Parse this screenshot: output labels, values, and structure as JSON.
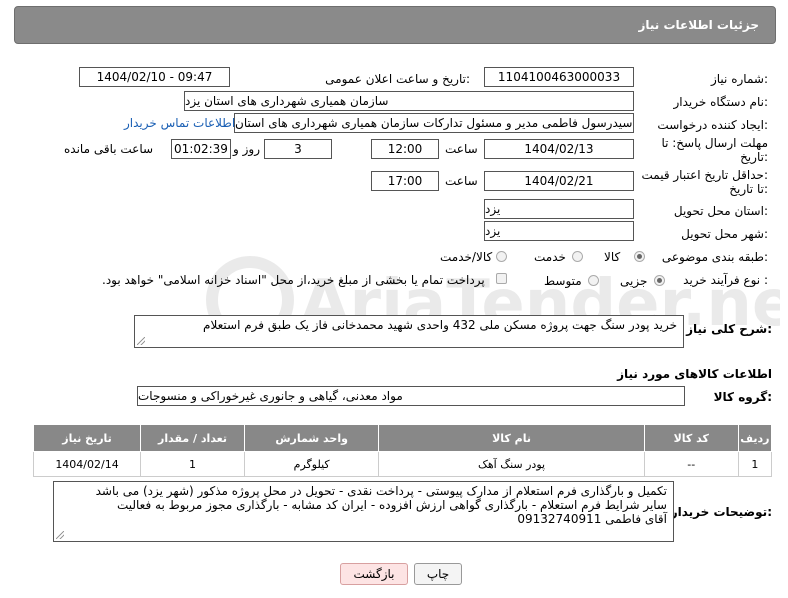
{
  "header": {
    "title": "جزئیات اطلاعات نیاز"
  },
  "form": {
    "need_number_label": "شماره نیاز:",
    "need_number": "1104100463000033",
    "announce_label": "تاریخ و ساعت اعلان عمومی:",
    "announce_value": "1404/02/10 - 09:47",
    "buyer_org_label": "نام دستگاه خریدار:",
    "buyer_org": "سازمان همیاری شهرداری های استان یزد",
    "creator_label": "ایجاد کننده درخواست:",
    "creator": "سیدرسول فاطمی مدیر و مسئول تدارکات سازمان همیاری شهرداری های استان",
    "contact_link": "اطلاعات تماس خریدار",
    "deadline_label_1": "مهلت ارسال پاسخ: تا",
    "deadline_label_2": "تاریخ:",
    "deadline_date": "1404/02/13",
    "time_label": "ساعت",
    "deadline_time": "12:00",
    "days_value": "3",
    "days_label": "روز و",
    "remaining_time": "01:02:39",
    "remaining_label": "ساعت باقی مانده",
    "validity_label_1": "حداقل تاریخ اعتبار قیمت:",
    "validity_label_2": "تا تاریخ:",
    "validity_date": "1404/02/21",
    "validity_time": "17:00",
    "province_label": "استان محل تحویل:",
    "province": "یزد",
    "city_label": "شهر محل تحویل:",
    "city": "یزد",
    "category_label": "طبقه بندی موضوعی:",
    "category_options": [
      "کالا",
      "خدمت",
      "کالا/خدمت"
    ],
    "category_selected": "کالا",
    "process_label": "نوع فرآیند خرید :",
    "process_options": [
      "جزیی",
      "متوسط"
    ],
    "process_selected": "جزیی",
    "payment_note": "پرداخت تمام یا بخشی از مبلغ خرید،از محل \"اسناد خزانه اسلامی\" خواهد بود.",
    "description_label": "شرح کلی نیاز:",
    "description": "خرید پودر سنگ جهت پروژه مسکن ملی 432 واحدی شهید محمدخانی فاز یک طبق فرم استعلام"
  },
  "goods": {
    "section_title": "اطلاعات کالاهای مورد نیاز",
    "group_label": "گروه کالا:",
    "group_value": "مواد معدنی، گیاهی و جانوری غیرخوراکی و منسوجات",
    "columns": [
      "ردیف",
      "کد کالا",
      "نام کالا",
      "واحد شمارش",
      "تعداد / مقدار",
      "تاریخ نیاز"
    ],
    "rows": [
      {
        "row": "1",
        "code": "--",
        "name": "پودر سنگ آهک",
        "unit": "کیلوگرم",
        "qty": "1",
        "date": "1404/02/14"
      }
    ]
  },
  "buyer_notes": {
    "label": "توضیحات خریدار:",
    "lines": [
      "تکمیل و بارگذاری فرم استعلام از مدارک پیوستی - پرداخت نقدی - تحویل در محل پروژه مذکور (شهر یزد) می باشد",
      "سایر شرایط فرم استعلام - بارگذاری گواهی ارزش افزوده - ایران کد مشابه - بارگذاری مجوز مربوط به فعالیت",
      "آقای فاطمی 09132740911"
    ]
  },
  "buttons": {
    "print": "چاپ",
    "back": "بازگشت"
  },
  "watermark": "AriaTender.neT"
}
